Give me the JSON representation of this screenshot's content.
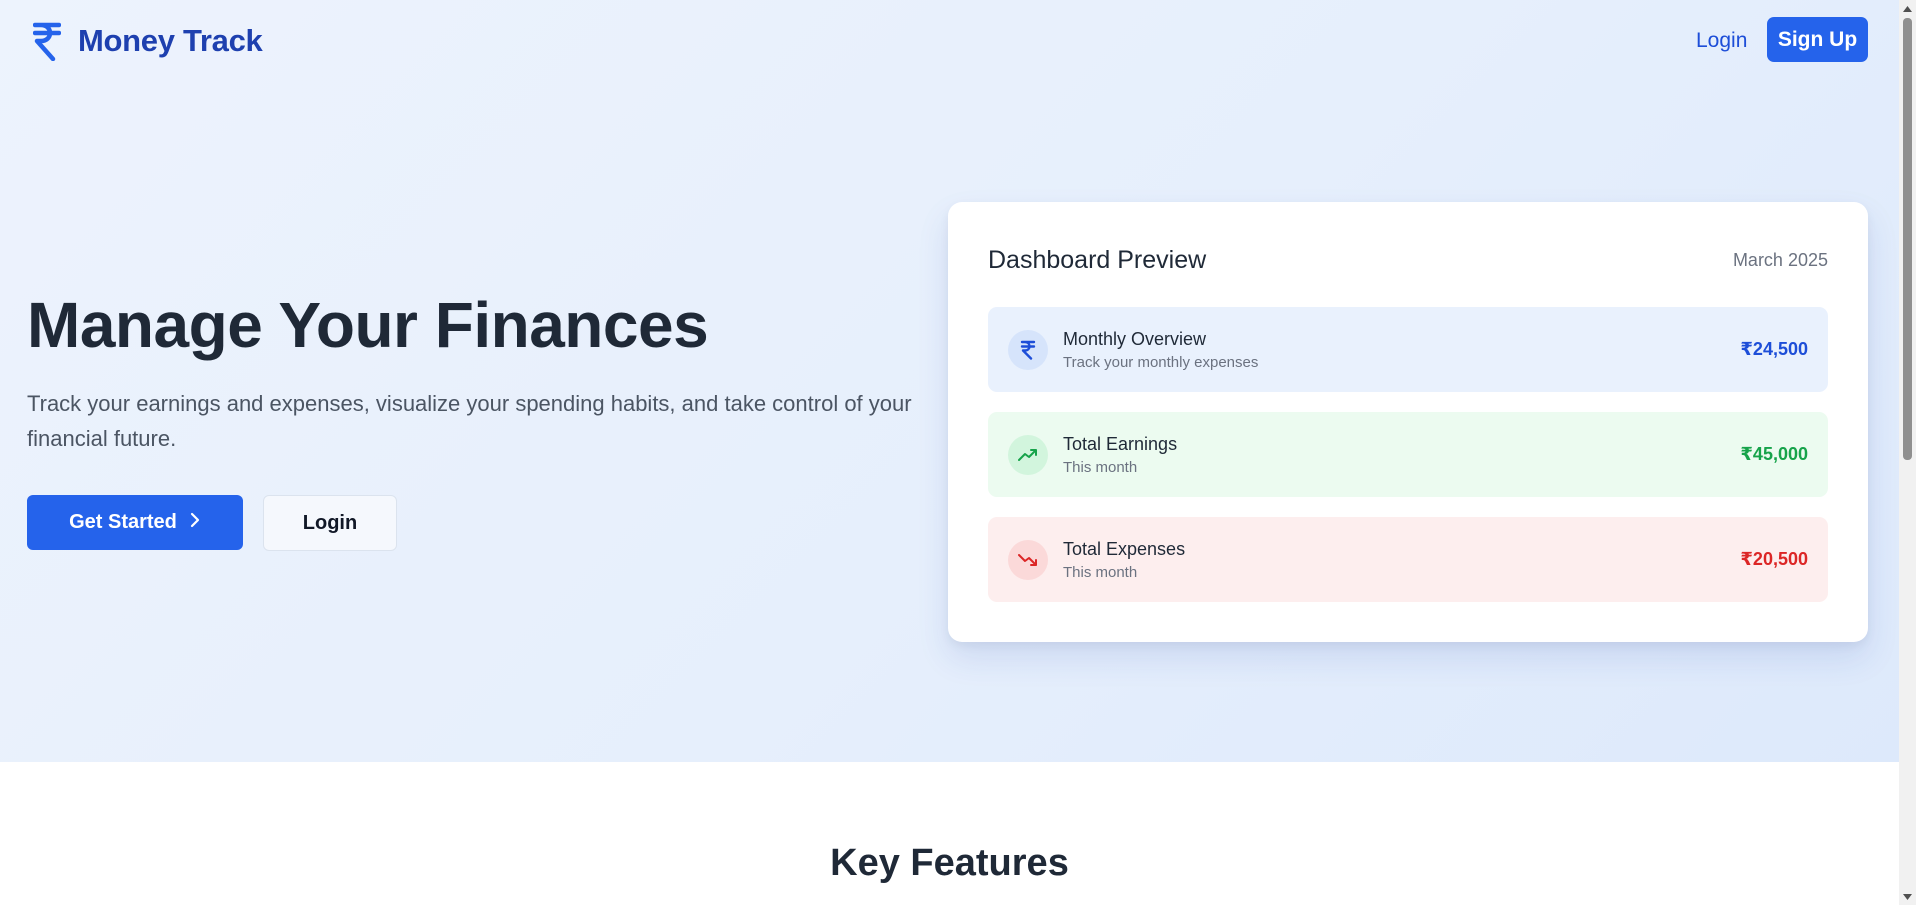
{
  "nav": {
    "brand_symbol": "₹",
    "brand_name": "Money Track",
    "login_label": "Login",
    "signup_label": "Sign Up"
  },
  "hero": {
    "title": "Manage Your Finances",
    "description": "Track your earnings and expenses, visualize your spending habits, and take control of your financial future.",
    "get_started_label": "Get Started",
    "login_label": "Login"
  },
  "dashboard": {
    "title": "Dashboard Preview",
    "date": "March 2025",
    "rows": [
      {
        "title": "Monthly Overview",
        "subtitle": "Track your monthly expenses",
        "amount": "₹24,500",
        "icon": "rupee-icon"
      },
      {
        "title": "Total Earnings",
        "subtitle": "This month",
        "amount": "₹45,000",
        "icon": "trending-up-icon"
      },
      {
        "title": "Total Expenses",
        "subtitle": "This month",
        "amount": "₹20,500",
        "icon": "trending-down-icon"
      }
    ]
  },
  "features": {
    "title": "Key Features"
  },
  "colors": {
    "primary": "#2563eb",
    "brand_text": "#1e40af",
    "earnings": "#16a34a",
    "expenses": "#dc2626"
  }
}
